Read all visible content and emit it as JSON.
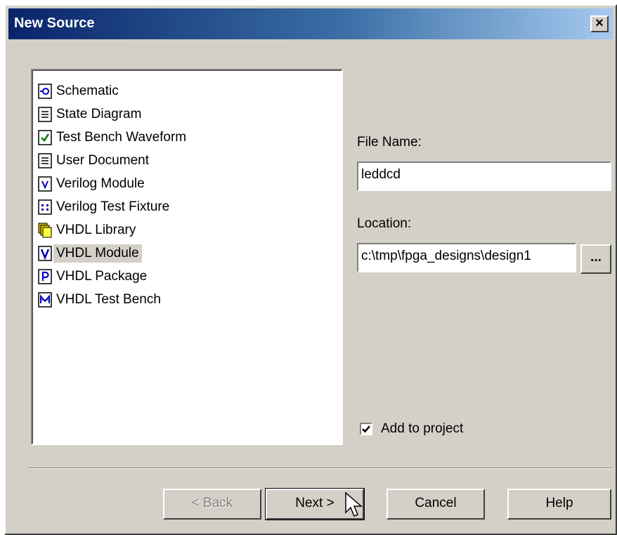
{
  "window": {
    "title": "New Source",
    "close_glyph": "×"
  },
  "source_types": [
    {
      "label": "Schematic",
      "icon": "schematic-icon"
    },
    {
      "label": "State Diagram",
      "icon": "document-icon"
    },
    {
      "label": "Test Bench Waveform",
      "icon": "check-icon"
    },
    {
      "label": "User Document",
      "icon": "document-icon"
    },
    {
      "label": "Verilog Module",
      "icon": "verilog-module-icon"
    },
    {
      "label": "Verilog Test Fixture",
      "icon": "verilog-fixture-icon"
    },
    {
      "label": "VHDL Library",
      "icon": "library-icon"
    },
    {
      "label": "VHDL Module",
      "icon": "vhdl-module-icon",
      "selected": true
    },
    {
      "label": "VHDL Package",
      "icon": "vhdl-package-icon"
    },
    {
      "label": "VHDL Test Bench",
      "icon": "vhdl-testbench-icon"
    }
  ],
  "file_name": {
    "label": "File Name:",
    "value": "leddcd"
  },
  "location": {
    "label": "Location:",
    "value": "c:\\tmp\\fpga_designs\\design1",
    "browse_label": "..."
  },
  "add_to_project": {
    "label": "Add to project",
    "checked": true
  },
  "buttons": {
    "back": "< Back",
    "next": "Next >",
    "cancel": "Cancel",
    "help": "Help"
  },
  "colors": {
    "face": "#d4d0c8",
    "title_start": "#0a246a",
    "title_end": "#a6caf0",
    "icon_blue": "#0000c0"
  }
}
